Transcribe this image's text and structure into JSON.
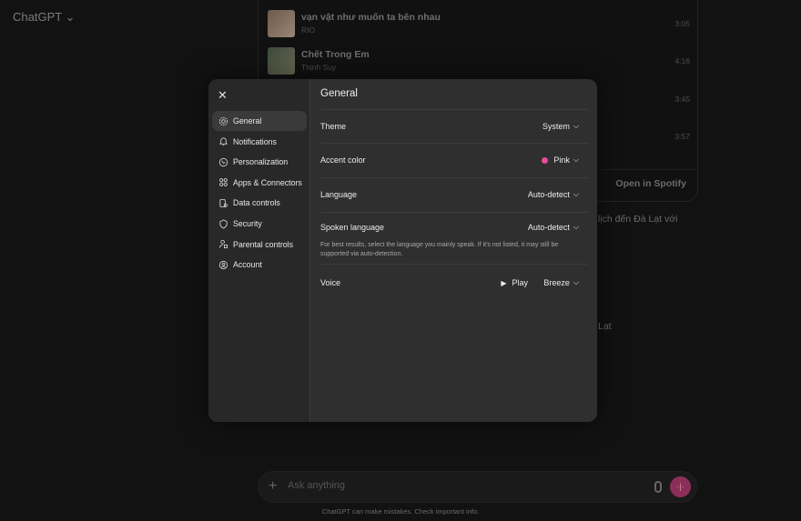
{
  "app": {
    "title": "ChatGPT"
  },
  "spotify": {
    "tracks": [
      {
        "name": "vạn vật như muốn ta bên nhau",
        "artist": "RIO",
        "duration": "3:05"
      },
      {
        "name": "Chết Trong Em",
        "artist": "Thịnh Suy",
        "duration": "4:16"
      },
      {
        "name": "",
        "artist": "",
        "duration": "3:45"
      },
      {
        "name": "",
        "artist": "",
        "duration": "3:57"
      }
    ],
    "open_label": "Open in Spotify"
  },
  "background_text": [
    "lịch đến Đà Lạt với",
    "Lạt"
  ],
  "settings": {
    "title": "General",
    "nav": [
      {
        "label": "General",
        "icon": "gear-icon",
        "active": true
      },
      {
        "label": "Notifications",
        "icon": "bell-icon"
      },
      {
        "label": "Personalization",
        "icon": "personalization-icon"
      },
      {
        "label": "Apps & Connectors",
        "icon": "apps-icon"
      },
      {
        "label": "Data controls",
        "icon": "database-icon"
      },
      {
        "label": "Security",
        "icon": "shield-icon"
      },
      {
        "label": "Parental controls",
        "icon": "parental-icon"
      },
      {
        "label": "Account",
        "icon": "account-icon"
      }
    ],
    "rows": {
      "theme": {
        "label": "Theme",
        "value": "System"
      },
      "accent": {
        "label": "Accent color",
        "value": "Pink",
        "color": "#e84b9a"
      },
      "language": {
        "label": "Language",
        "value": "Auto-detect"
      },
      "spoken": {
        "label": "Spoken language",
        "value": "Auto-detect",
        "help": "For best results, select the language you mainly speak. If it's not listed, it may still be supported via auto-detection."
      },
      "voice": {
        "label": "Voice",
        "play": "Play",
        "value": "Breeze"
      }
    }
  },
  "composer": {
    "placeholder": "Ask anything",
    "disclaimer": "ChatGPT can make mistakes. Check important info."
  }
}
